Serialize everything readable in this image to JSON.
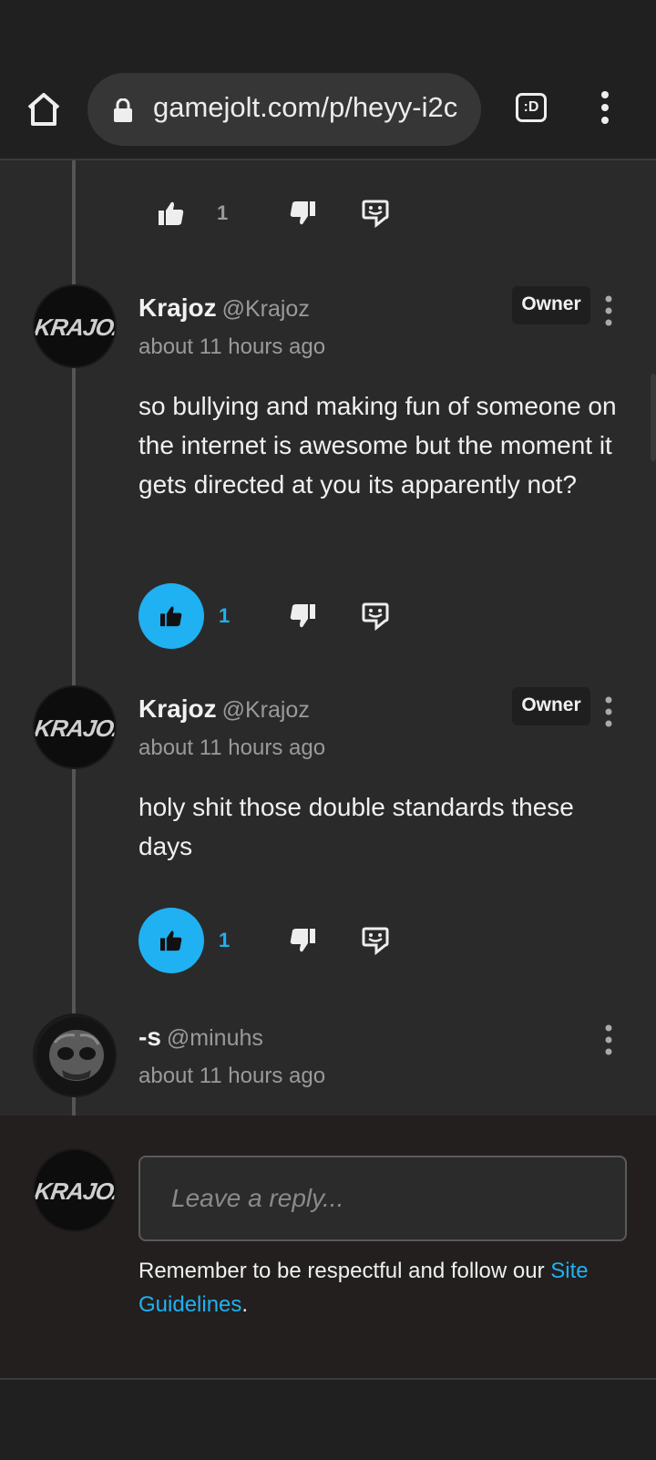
{
  "browser": {
    "url": "gamejolt.com/p/heyy-i2c",
    "tabs_label": ":D"
  },
  "top_actions": {
    "like_count": "1"
  },
  "comments": [
    {
      "avatar_text": "KRAJOZ",
      "name": "Krajoz",
      "handle": "@Krajoz",
      "badge": "Owner",
      "time": "about 11 hours ago",
      "body": "so bullying and making fun of someone on the internet is awesome but the moment it gets directed at you its apparently not?",
      "like_count": "1"
    },
    {
      "avatar_text": "KRAJOZ",
      "name": "Krajoz",
      "handle": "@Krajoz",
      "badge": "Owner",
      "time": "about 11 hours ago",
      "body": "holy shit those double standards these days",
      "like_count": "1"
    },
    {
      "name": "-s",
      "handle": "@minuhs",
      "time": "about 11 hours ago"
    }
  ],
  "reply": {
    "avatar_text": "KRAJOZ",
    "placeholder": "Leave a reply...",
    "note_prefix": "Remember to be respectful and follow our",
    "guidelines_link": "Site Guidelines",
    "note_suffix": "."
  },
  "colors": {
    "accent": "#1fb1f2",
    "background": "#2b2a2a",
    "toolbar": "#202020"
  }
}
